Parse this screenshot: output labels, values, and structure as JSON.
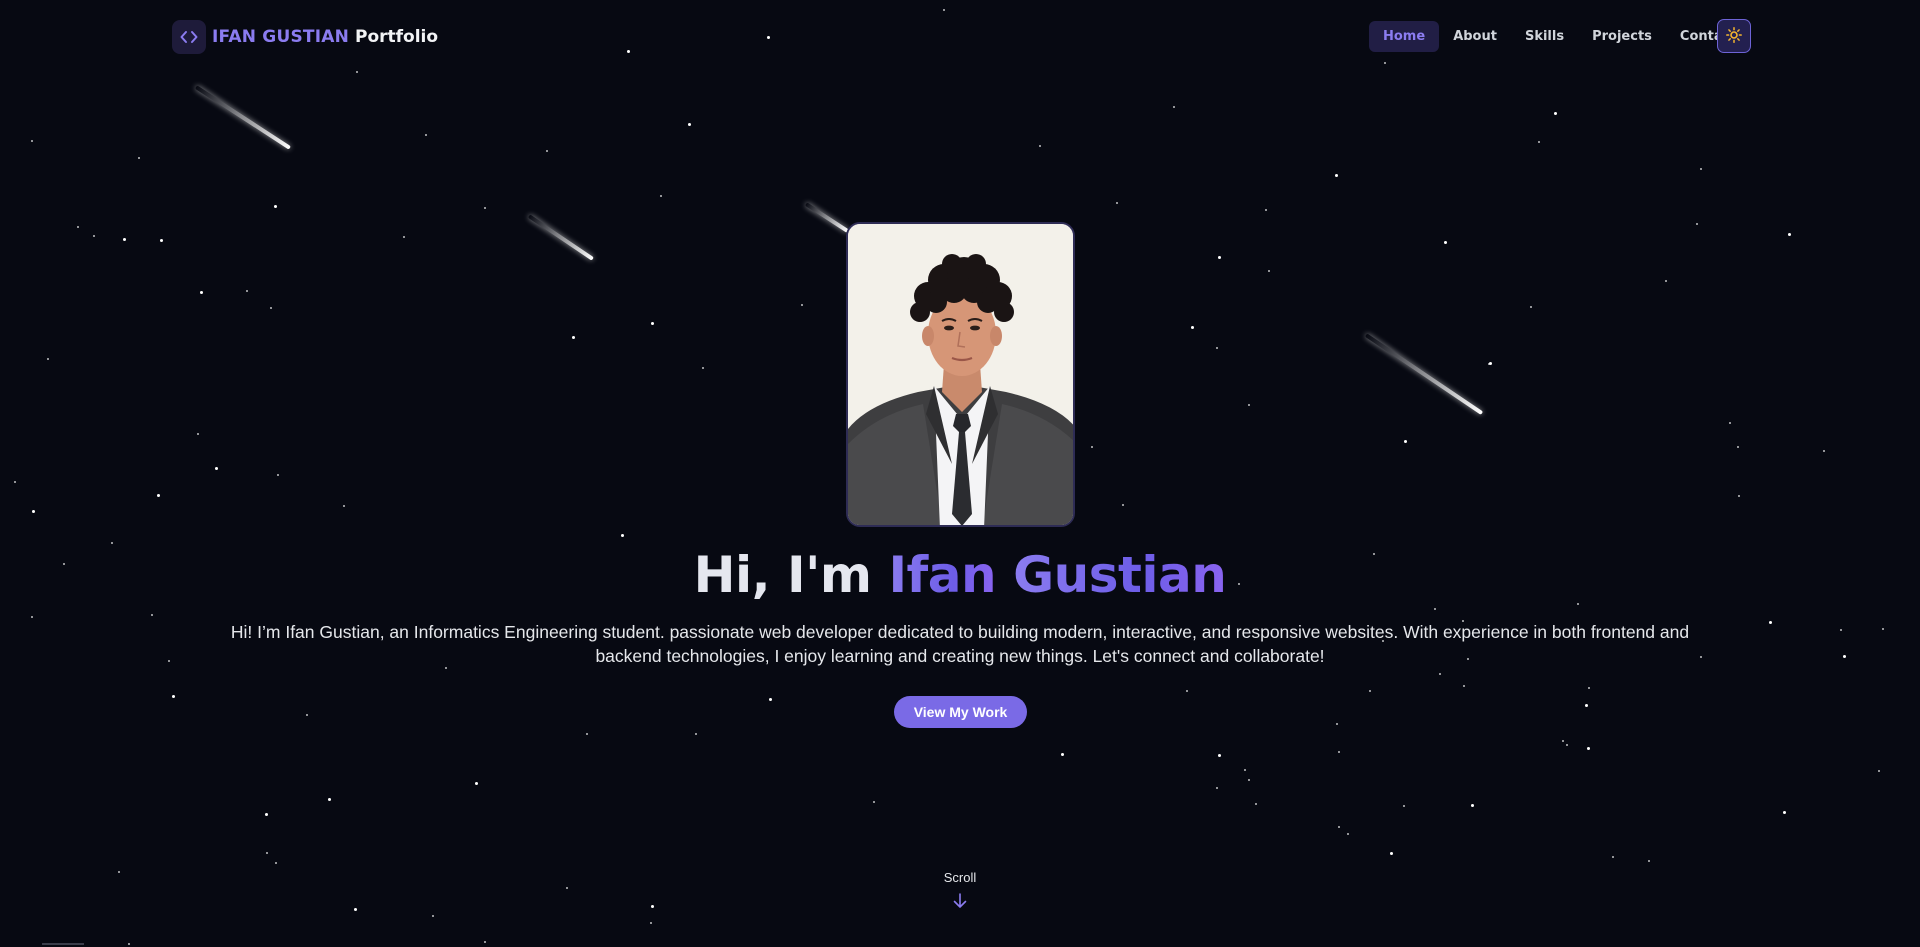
{
  "header": {
    "logo_icon": "code-brackets-icon",
    "logo_name": "IFAN GUSTIAN",
    "logo_suffix": "Portfolio",
    "nav": [
      {
        "label": "Home",
        "active": true
      },
      {
        "label": "About",
        "active": false
      },
      {
        "label": "Skills",
        "active": false
      },
      {
        "label": "Projects",
        "active": false
      },
      {
        "label": "Contact",
        "active": false
      }
    ],
    "theme_toggle_icon": "sun-icon"
  },
  "hero": {
    "photo_alt": "Portrait of Ifan Gustian in a dark suit and tie",
    "greeting": "Hi, I'm",
    "name_first": "Ifan",
    "name_last": "Gustian",
    "description": "Hi! I’m Ifan Gustian, an Informatics Engineering student. passionate web developer dedicated to building modern, interactive, and responsive websites. With experience in both frontend and backend technologies, I enjoy learning and creating new things. Let's connect and collaborate!",
    "cta_label": "View My Work"
  },
  "scroll": {
    "label": "Scroll",
    "icon": "arrow-down-icon"
  },
  "colors": {
    "background": "#070912",
    "accent": "#8b7cf0",
    "button": "#7a6ae6",
    "nav_active_bg": "#211e45",
    "sun": "#f5b52e"
  }
}
